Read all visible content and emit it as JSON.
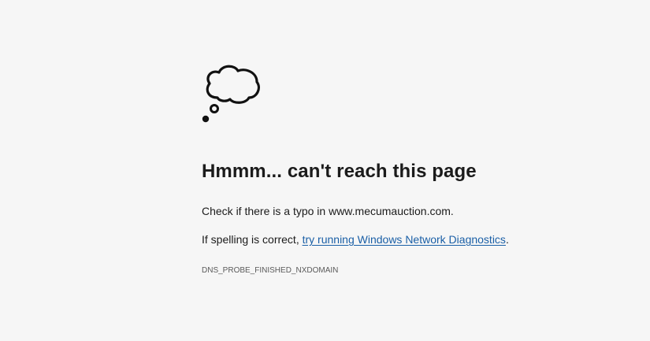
{
  "error": {
    "icon": "thought-cloud-icon",
    "headline": "Hmmm... can't reach this page",
    "typo_prefix": "Check if there is a typo in ",
    "domain": "www.mecumauction.com",
    "typo_suffix": ".",
    "spelling_prefix": "If spelling is correct, ",
    "diagnostics_link": "try running Windows Network Diagnostics",
    "spelling_suffix": ".",
    "error_code": "DNS_PROBE_FINISHED_NXDOMAIN"
  },
  "colors": {
    "background": "#f6f6f6",
    "link": "#1a5fa6",
    "text": "#1b1b1b",
    "code": "#5a5a5a"
  }
}
